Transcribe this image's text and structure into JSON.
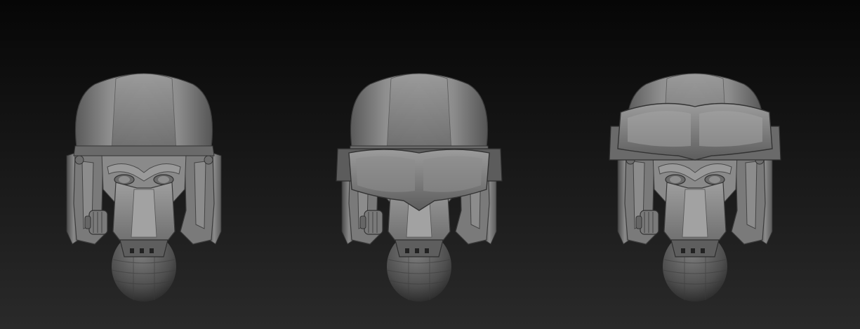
{
  "scene": {
    "background_top": "#060606",
    "background_bottom": "#2a2a2a",
    "material_light": "#b4b4b4",
    "material_mid": "#7c7c7c",
    "material_dark": "#3a3a3a"
  },
  "models": [
    {
      "variant": "helmet-goggles-off"
    },
    {
      "variant": "helmet-goggles-down"
    },
    {
      "variant": "helmet-goggles-up"
    }
  ]
}
